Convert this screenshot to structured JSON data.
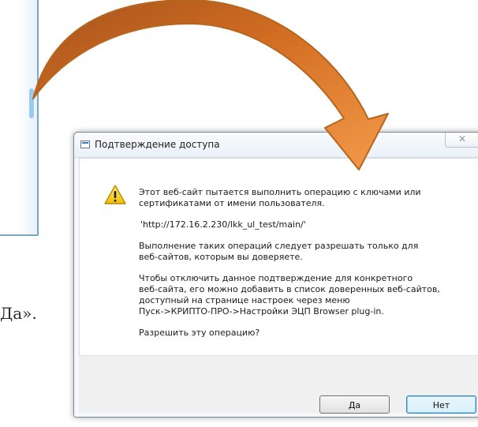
{
  "background": {
    "text": "Да»."
  },
  "dialog": {
    "title": "Подтверждение доступа",
    "close_glyph": "✕",
    "paragraphs": [
      "Этот веб-сайт пытается выполнить операцию с ключами или",
      "сертификатами от имени пользователя."
    ],
    "url": "'http://172.16.2.230/lkk_ul_test/main/'",
    "warning_lines": [
      "Выполнение таких операций следует разрешать только для",
      "веб-сайтов, которым вы доверяете."
    ],
    "instruction_lines": [
      "Чтобы отключить данное подтверждение для конкретного",
      "веб-сайта, его можно добавить в список доверенных веб-сайтов,",
      "доступный на странице настроек через меню",
      "Пуск->КРИПТО-ПРО->Настройки ЭЦП Browser plug-in."
    ],
    "question": "Разрешить эту операцию?",
    "yes_label": "Да",
    "no_label": "Нет"
  },
  "icons": {
    "window": "window-icon",
    "close": "close-icon",
    "warning": "warning-icon",
    "arrow": "arrow-icon"
  },
  "colors": {
    "arrow": "#e97a25",
    "arrow_border": "#b7661d",
    "dialog_border": "#7d8b99",
    "no_button": "#3c7fb1"
  }
}
